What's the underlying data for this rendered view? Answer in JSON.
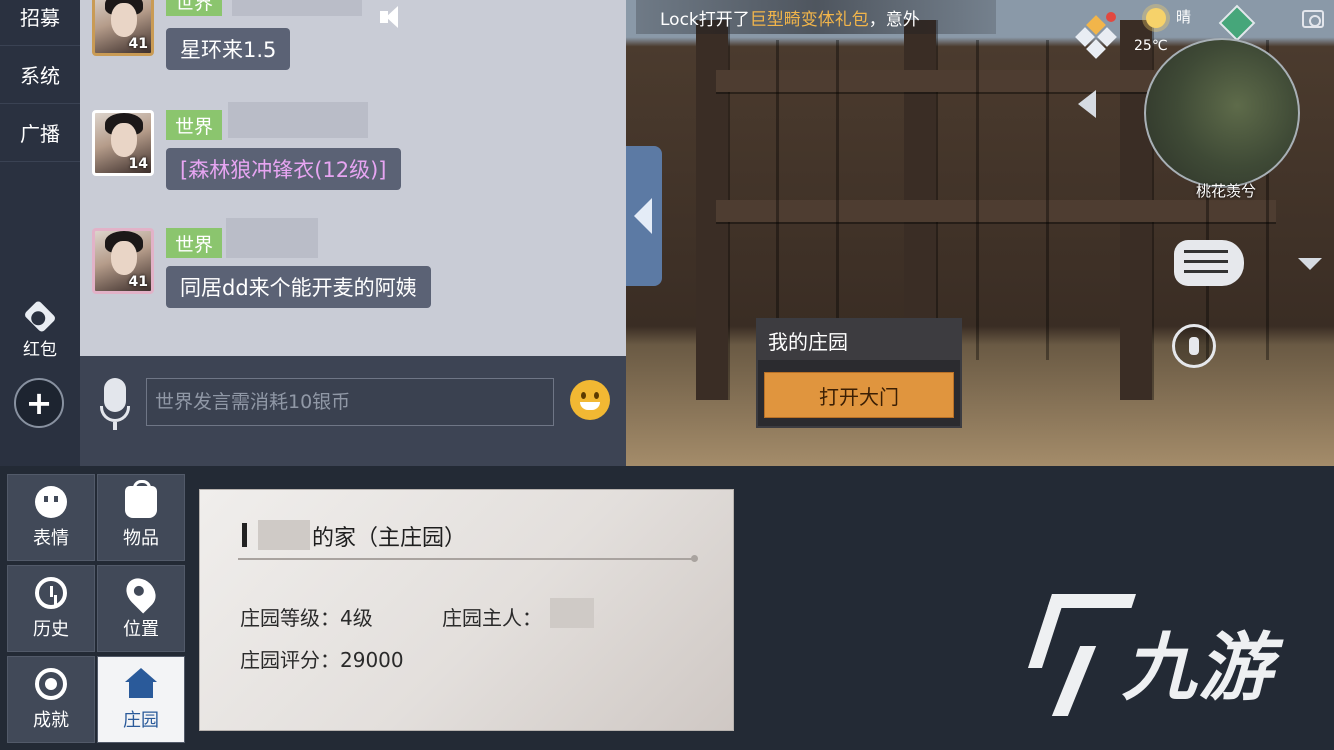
{
  "left_nav": {
    "items": [
      "招募",
      "系统",
      "广播"
    ],
    "redpack_label": "红包",
    "plus_label": "+"
  },
  "chat": {
    "messages": [
      {
        "channel": "世界",
        "level": "41",
        "text": "星环来1.5",
        "type": "text"
      },
      {
        "channel": "世界",
        "level": "14",
        "text": "[森林狼冲锋衣(12级)]",
        "type": "item"
      },
      {
        "channel": "世界",
        "level": "41",
        "text": "同居dd来个能开麦的阿姨",
        "type": "text"
      }
    ],
    "input_placeholder": "世界发言需消耗10银币"
  },
  "game": {
    "notice_prefix": "Lock打开了",
    "notice_item": "巨型畸变体礼包",
    "notice_suffix": "，意外",
    "weather": "晴",
    "temperature": "25℃",
    "minimap_place": "桃花羡兮",
    "popup_title": "我的庄园",
    "popup_button": "打开大门",
    "colors": {
      "highlight": "#f2b54a",
      "button": "#e0953e"
    }
  },
  "bottom_menu": {
    "items": [
      {
        "label": "表情",
        "icon": "smiley-icon"
      },
      {
        "label": "物品",
        "icon": "bag-icon"
      },
      {
        "label": "历史",
        "icon": "history-icon"
      },
      {
        "label": "位置",
        "icon": "location-pin-icon"
      },
      {
        "label": "成就",
        "icon": "medal-icon"
      },
      {
        "label": "庄园",
        "icon": "house-icon",
        "active": true
      }
    ]
  },
  "manor_card": {
    "title": "的家（主庄园）",
    "level_label": "庄园等级：",
    "level_value": "4级",
    "owner_label": "庄园主人：",
    "score_label": "庄园评分：",
    "score_value": "29000"
  },
  "watermark": {
    "text": "九游"
  }
}
